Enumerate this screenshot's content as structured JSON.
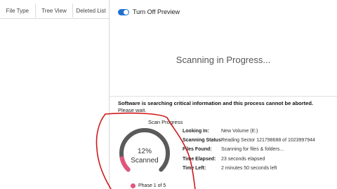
{
  "tabs": [
    {
      "label": "File Type"
    },
    {
      "label": "Tree View"
    },
    {
      "label": "Deleted List"
    }
  ],
  "preview_toggle": {
    "label": "Turn Off Preview",
    "on": true
  },
  "scan_title": "Scanning in Progress...",
  "message": {
    "main": "Software is searching critical information and this process cannot be aborted.",
    "sub": "Please wait."
  },
  "progress": {
    "label": "Scan Progress",
    "percent_text": "12%",
    "percent_value": 12,
    "status_word": "Scanned",
    "phase": "Phase 1 of 5"
  },
  "details": [
    {
      "key": "Looking In:",
      "value": "New Volume (E:)"
    },
    {
      "key": "Scanning Status:",
      "value": "Reading Sector 121798688 of 1023997944"
    },
    {
      "key": "Files Found:",
      "value": "Scanning for files & folders..."
    },
    {
      "key": "Time Elapsed:",
      "value": "23 seconds elapsed"
    },
    {
      "key": "Time Left:",
      "value": "2 minutes 50 seconds left"
    }
  ],
  "colors": {
    "accent": "#1f6fd1",
    "progress": "#e2557a",
    "annotation": "#d01818",
    "gauge_track": "#5a5a5a"
  }
}
